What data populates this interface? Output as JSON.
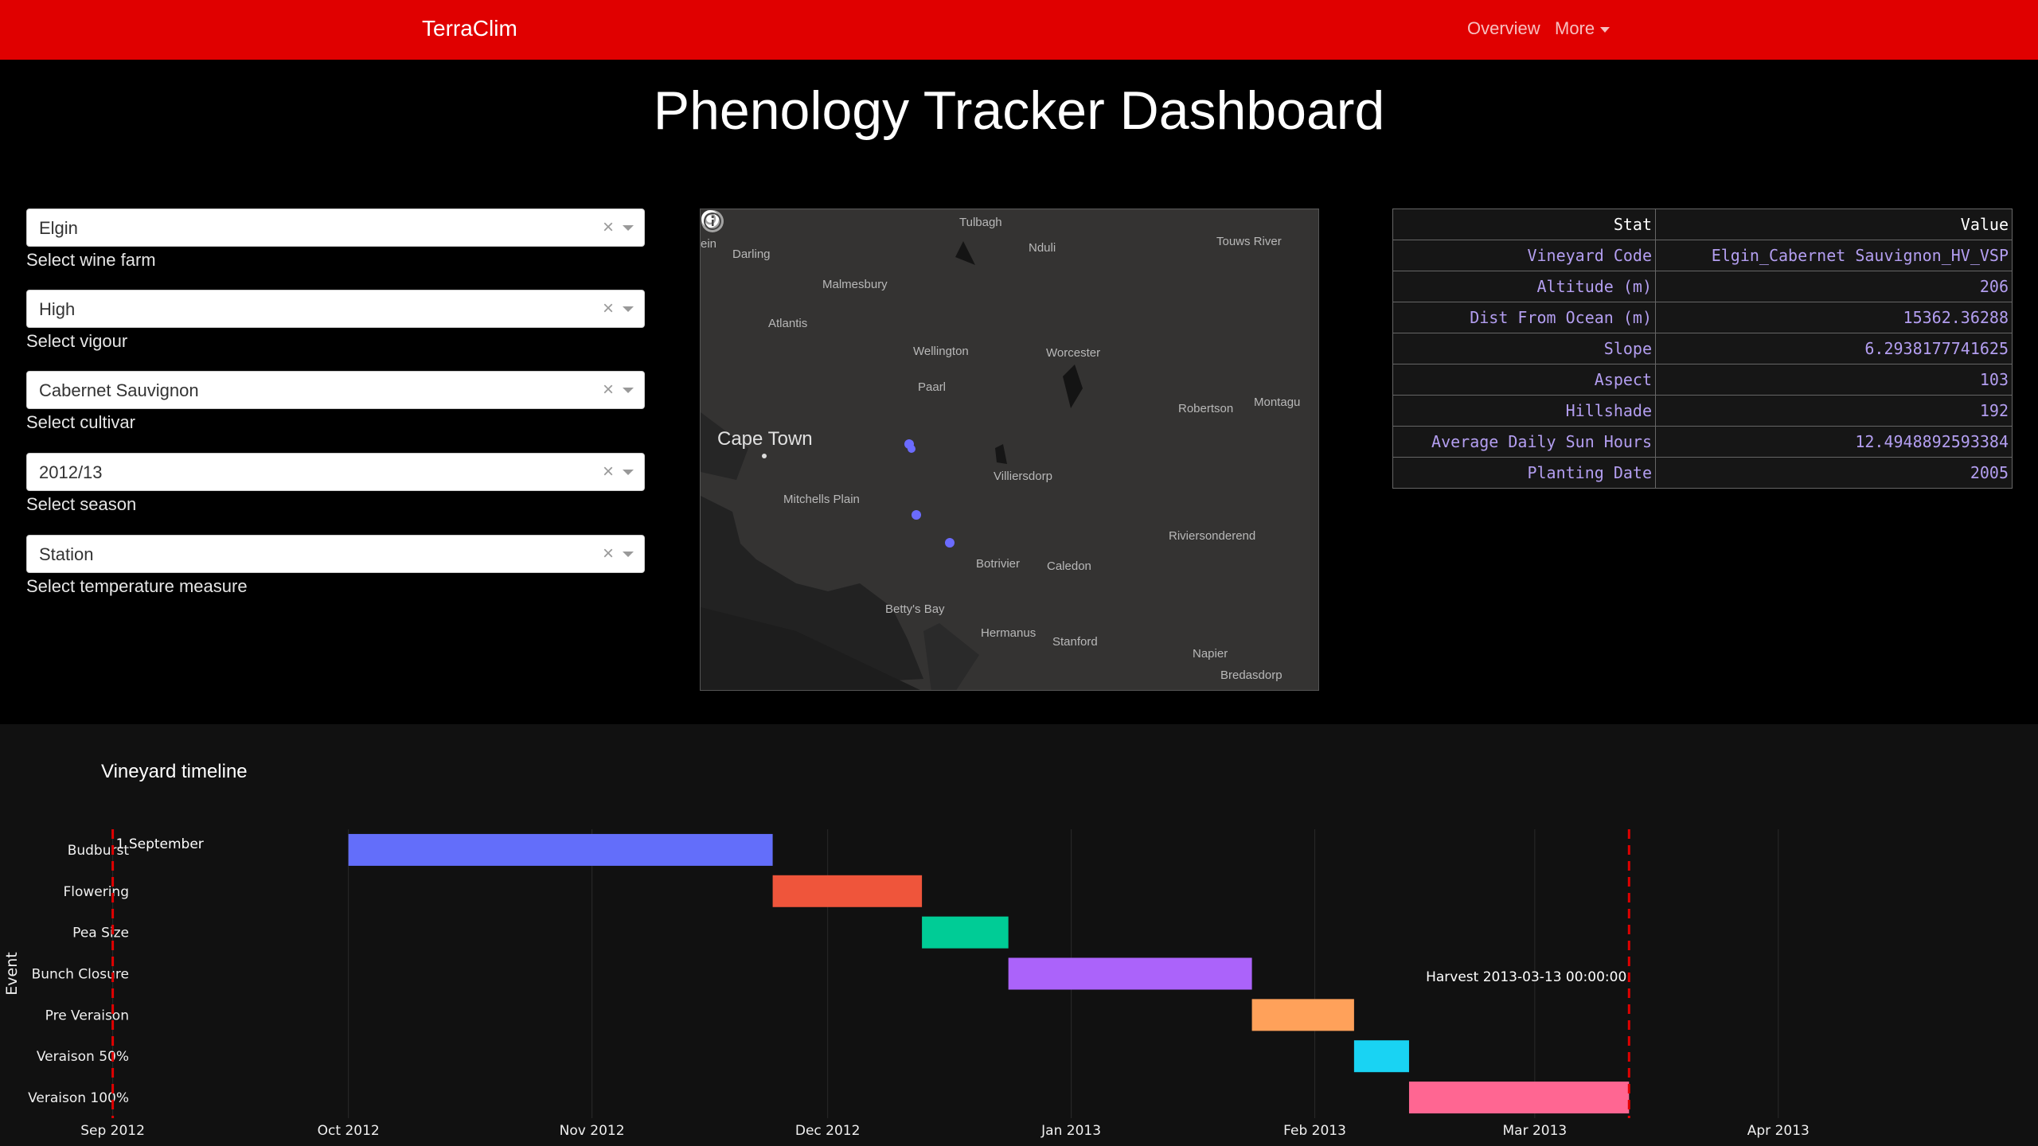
{
  "navbar": {
    "brand": "TerraClim",
    "links": [
      "Overview",
      "More"
    ]
  },
  "page_title": "Phenology Tracker Dashboard",
  "dropdowns": [
    {
      "value": "Elgin",
      "label": "Select wine farm"
    },
    {
      "value": "High",
      "label": "Select vigour"
    },
    {
      "value": "Cabernet Sauvignon",
      "label": "Select cultivar"
    },
    {
      "value": "2012/13",
      "label": "Select season"
    },
    {
      "value": "Station",
      "label": "Select temperature measure"
    }
  ],
  "clear_glyph": "×",
  "map": {
    "places": [
      "Tulbagh",
      "Nduli",
      "Touws River",
      "Darling",
      "Malmesbury",
      "Atlantis",
      "Wellington",
      "Worcester",
      "Paarl",
      "Robertson",
      "Montagu",
      "Cape Town",
      "Villiersdorp",
      "Mitchells Plain",
      "Riviersonderend",
      "Botrivier",
      "Caledon",
      "Betty's Bay",
      "Hermanus",
      "Stanford",
      "Napier",
      "Bredasdorp",
      "ein"
    ],
    "marker_color": "#6b6bff"
  },
  "stats_table": {
    "headers": [
      "Stat",
      "Value"
    ],
    "rows": [
      [
        "Vineyard Code",
        "Elgin_Cabernet Sauvignon_HV_VSP"
      ],
      [
        "Altitude (m)",
        "206"
      ],
      [
        "Dist From Ocean (m)",
        "15362.36288"
      ],
      [
        "Slope",
        "6.2938177741625"
      ],
      [
        "Aspect",
        "103"
      ],
      [
        "Hillshade",
        "192"
      ],
      [
        "Average Daily Sun Hours",
        "12.4948892593384"
      ],
      [
        "Planting Date",
        "2005"
      ]
    ]
  },
  "timeline": {
    "title": "Vineyard timeline",
    "y_axis_label": "Event",
    "start_annotation": "1 September",
    "harvest_annotation": "Harvest  2013-03-13 00:00:00"
  },
  "chart_data": {
    "type": "bar",
    "orientation": "horizontal-gantt",
    "title": "Vineyard timeline",
    "ylabel": "Event",
    "x_ticks": [
      "Sep 2012",
      "Oct 2012",
      "Nov 2012",
      "Dec 2012",
      "Jan 2013",
      "Feb 2013",
      "Mar 2013",
      "Apr 2013"
    ],
    "x_range": [
      "2012-08-29",
      "2013-04-30"
    ],
    "tasks": [
      {
        "event": "Budburst",
        "start": "2012-10-01",
        "end": "2012-11-24",
        "color": "#636efa"
      },
      {
        "event": "Flowering",
        "start": "2012-11-24",
        "end": "2012-12-13",
        "color": "#ef553b"
      },
      {
        "event": "Pea Size",
        "start": "2012-12-13",
        "end": "2012-12-24",
        "color": "#00cc96"
      },
      {
        "event": "Bunch Closure",
        "start": "2012-12-24",
        "end": "2013-01-24",
        "color": "#ab63fa"
      },
      {
        "event": "Pre Veraison",
        "start": "2013-01-24",
        "end": "2013-02-06",
        "color": "#ffa15a"
      },
      {
        "event": "Veraison 50%",
        "start": "2013-02-06",
        "end": "2013-02-13",
        "color": "#19d3f3"
      },
      {
        "event": "Veraison 100%",
        "start": "2013-02-13",
        "end": "2013-03-13",
        "color": "#ff6692"
      }
    ],
    "markers": [
      {
        "label": "1 September",
        "date": "2012-09-01",
        "color": "#e00000"
      },
      {
        "label": "Harvest  2013-03-13 00:00:00",
        "date": "2013-03-13",
        "color": "#e00000"
      }
    ]
  }
}
